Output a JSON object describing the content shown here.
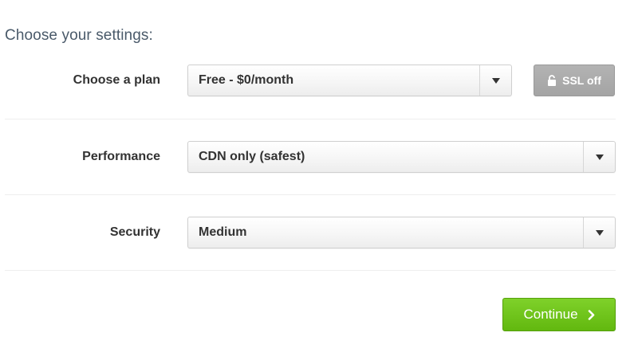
{
  "heading": "Choose your settings:",
  "plan": {
    "label": "Choose a plan",
    "value": "Free - $0/month",
    "icon": "chevron-down-icon"
  },
  "ssl": {
    "label": "SSL off",
    "icon": "unlock-icon",
    "color": "#a9a9a9"
  },
  "performance": {
    "label": "Performance",
    "value": "CDN only (safest)",
    "icon": "chevron-down-icon"
  },
  "security": {
    "label": "Security",
    "value": "Medium",
    "icon": "chevron-down-icon"
  },
  "continue": {
    "label": "Continue",
    "icon": "chevron-right-icon",
    "color": "#6cc21a"
  },
  "colors": {
    "heading": "#4a5a6a",
    "label": "#333333"
  }
}
